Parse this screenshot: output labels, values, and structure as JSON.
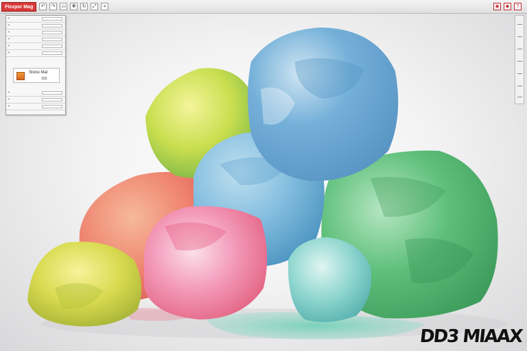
{
  "toolbar": {
    "logo_label": "Flexpor Mag",
    "buttons": [
      {
        "icon": "undo-icon",
        "glyph": "↶"
      },
      {
        "icon": "redo-icon",
        "glyph": "↷"
      },
      {
        "icon": "select-icon",
        "glyph": "▭"
      },
      {
        "icon": "move-icon",
        "glyph": "✥"
      },
      {
        "icon": "rotate-icon",
        "glyph": "↻"
      },
      {
        "icon": "scale-icon",
        "glyph": "⤢"
      },
      {
        "icon": "snap-icon",
        "glyph": "⌖"
      }
    ],
    "right_buttons": [
      {
        "icon": "camera-icon",
        "glyph": "◉"
      },
      {
        "icon": "render-icon",
        "glyph": "◆"
      },
      {
        "icon": "help-icon",
        "glyph": "?"
      }
    ],
    "brand_color": "#d83a3a"
  },
  "panel": {
    "card_title": "Stone Mat",
    "card_value": "103"
  },
  "watermark": "DD3 MIAAX",
  "colors": {
    "yellow": "#d9e36a",
    "blue": "#7fb4d6",
    "green": "#6cc48a",
    "pink": "#f08aa8",
    "coral": "#f28a7a",
    "teal": "#8fd6cf"
  }
}
